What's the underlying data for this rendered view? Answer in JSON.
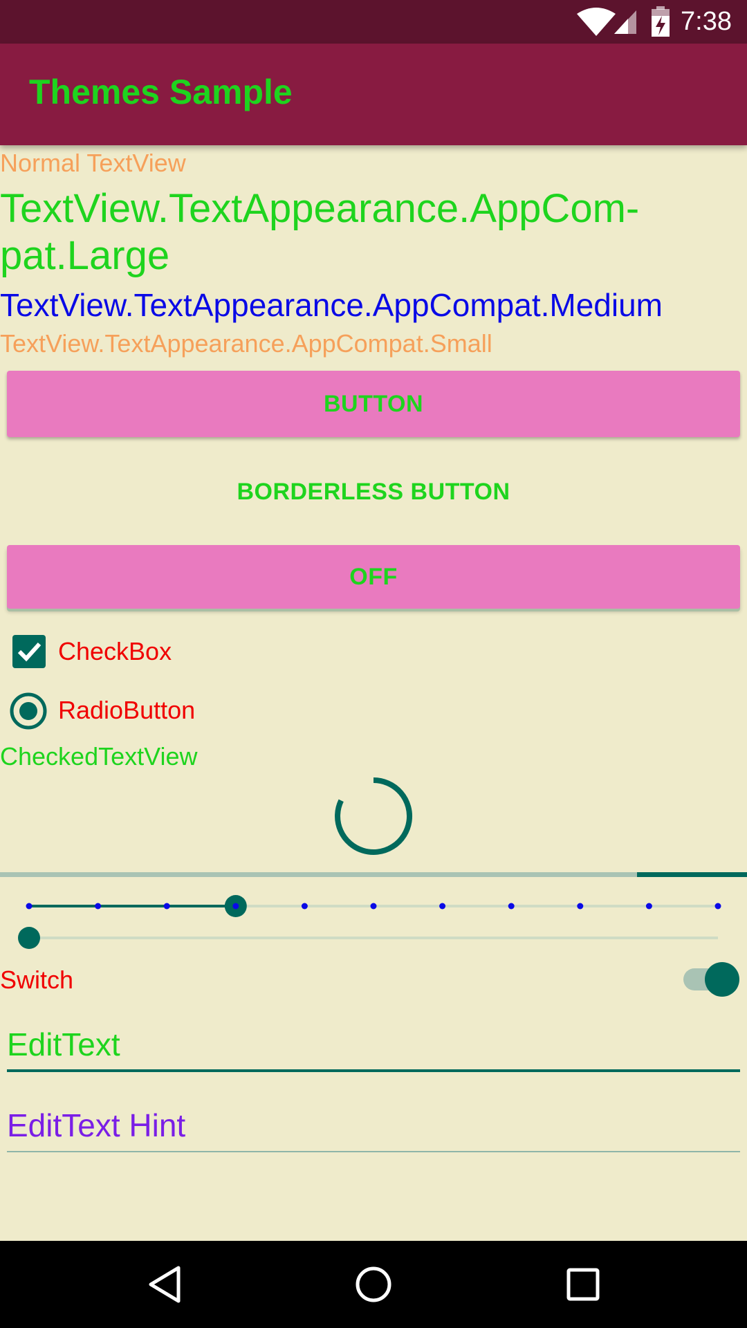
{
  "status_bar": {
    "time": "7:38",
    "icons": [
      "wifi-icon",
      "cell-signal-icon",
      "battery-charging-icon"
    ]
  },
  "app_bar": {
    "title": "Themes Sample"
  },
  "text_views": {
    "normal": "Normal TextView",
    "large_line1": "TextView.TextAppearance.AppCom-",
    "large_line2": "pat.Large",
    "medium": "TextView.TextAppearance.AppCompat.Medium",
    "small": "TextView.TextAppearance.AppCompat.Small"
  },
  "buttons": {
    "button": "BUTTON",
    "borderless": "BORDERLESS BUTTON",
    "toggle": "OFF"
  },
  "checkbox": {
    "label": "CheckBox",
    "checked": true
  },
  "radio": {
    "label": "RadioButton",
    "checked": true
  },
  "checked_text_view": "CheckedTextView",
  "progress": {
    "horizontal_fraction": 0.0
  },
  "discrete_seekbar": {
    "steps": 11,
    "selected_index": 3
  },
  "seekbar": {
    "value": 0.0
  },
  "switch": {
    "label": "Switch",
    "on": true
  },
  "edit_text": {
    "value": "EditText"
  },
  "edit_text_hint": {
    "placeholder": "EditText Hint"
  },
  "colors": {
    "status_bar": "#5C132D",
    "primary": "#881B41",
    "background": "#EFEBCB",
    "accent": "#00695C",
    "button": "#E97ABF",
    "text_green": "#1ED41E",
    "text_orange": "#F6A05A",
    "text_blue": "#0A0AE6",
    "text_red": "#F00000",
    "hint_purple": "#7A1EE6"
  },
  "nav_bar": {
    "icons": [
      "back-icon",
      "home-icon",
      "recents-icon"
    ]
  }
}
